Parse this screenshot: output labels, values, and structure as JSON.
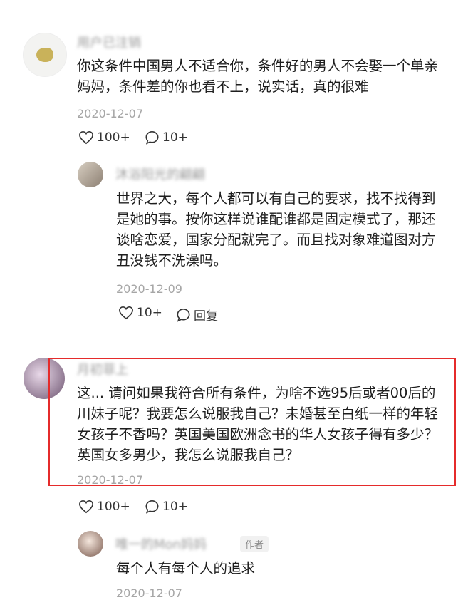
{
  "comments": [
    {
      "username": "用户已注销",
      "text": "你这条件中国男人不适合你，条件好的男人不会娶一个单亲妈妈，条件差的你也看不上，说实话，真的很难",
      "date": "2020-12-07",
      "likes": "100+",
      "replies": "10+"
    },
    {
      "username": "沐浴阳光的翩翩",
      "text": "世界之大，每个人都可以有自己的要求，找不找得到是她的事。按你这样说谁配谁都是固定模式了，那还谈啥恋爱，国家分配就完了。而且找对象难道图对方丑没钱不洗澡吗。",
      "date": "2020-12-09",
      "likes": "10+",
      "reply_label": "回复"
    },
    {
      "username": "月初菲上",
      "text": "这... 请问如果我符合所有条件，为啥不选95后或者00后的川妹子呢？我要怎么说服我自己？未婚甚至白纸一样的年轻女孩子不香吗？英国美国欧洲念书的华人女孩子得有多少？英国女多男少，我怎么说服我自己？",
      "date": "2020-12-07",
      "likes": "100+",
      "replies": "10+"
    },
    {
      "username": "唯一的Mon妈妈",
      "author_tag": "作者",
      "text": "每个人有每个人的追求",
      "date": "2020-12-07"
    }
  ],
  "colors": {
    "highlight_border": "#e52b2b",
    "meta_gray": "#a6a6a6"
  }
}
